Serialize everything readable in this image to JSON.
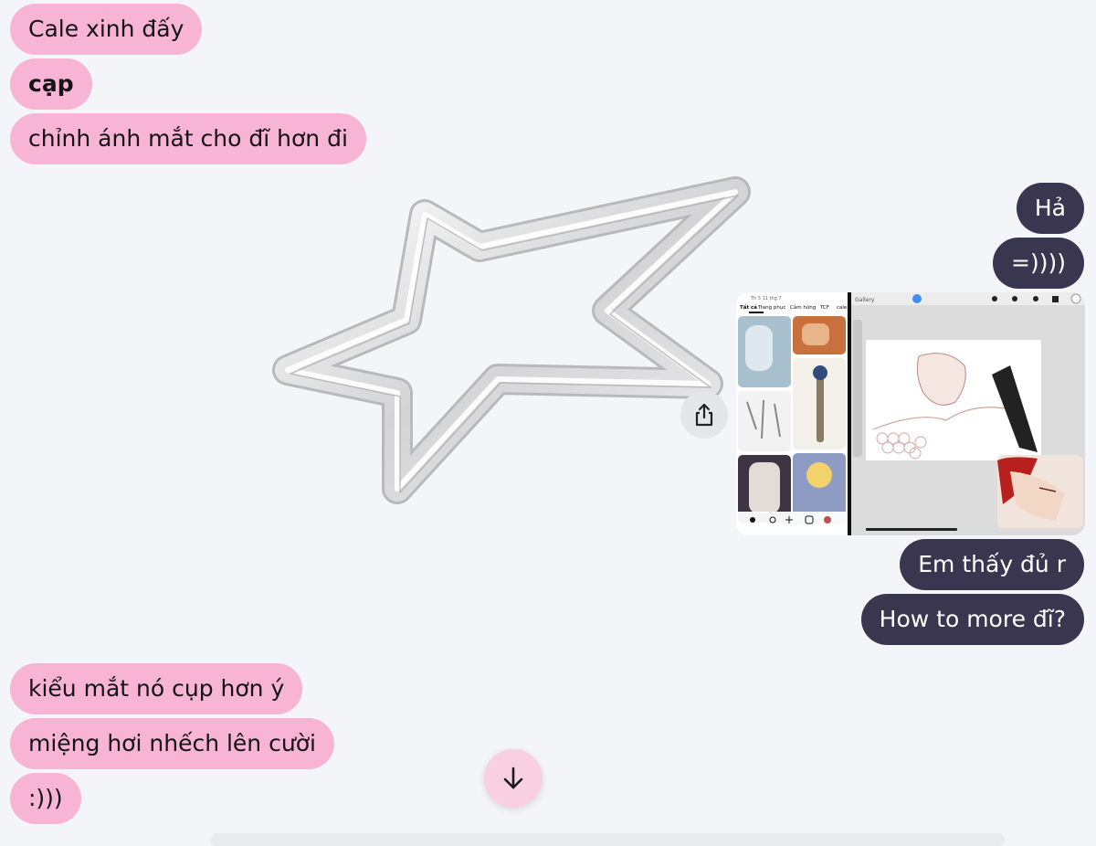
{
  "messages": {
    "incoming_top": [
      "Cale xinh đấy",
      "cạp",
      "chỉnh ánh mắt cho đĩ hơn đi"
    ],
    "outgoing": [
      "Hả",
      "=))))",
      "Em thấy đủ r",
      "How to more đĩ?"
    ],
    "incoming_bottom": [
      "kiểu mắt nó cụp hơn ý",
      "miệng hơi nhếch lên cười",
      ":)))"
    ]
  },
  "shared_image": {
    "left_panel": {
      "status": "Th 5 11 thg 7",
      "tabs": [
        "Tất cả",
        "Trang phục",
        "Cảm hứng",
        "TCF",
        "cale"
      ]
    },
    "right_panel": {
      "gallery_label": "Gallery"
    }
  },
  "icons": {
    "share": "share-icon",
    "scroll_down": "arrow-down-icon",
    "sticker": "star-sticker"
  },
  "colors": {
    "background": "#f4f5f9",
    "incoming_bubble": "#f8b4d4",
    "outgoing_bubble": "#3a3650",
    "scroll_button": "#f9d0e2"
  }
}
